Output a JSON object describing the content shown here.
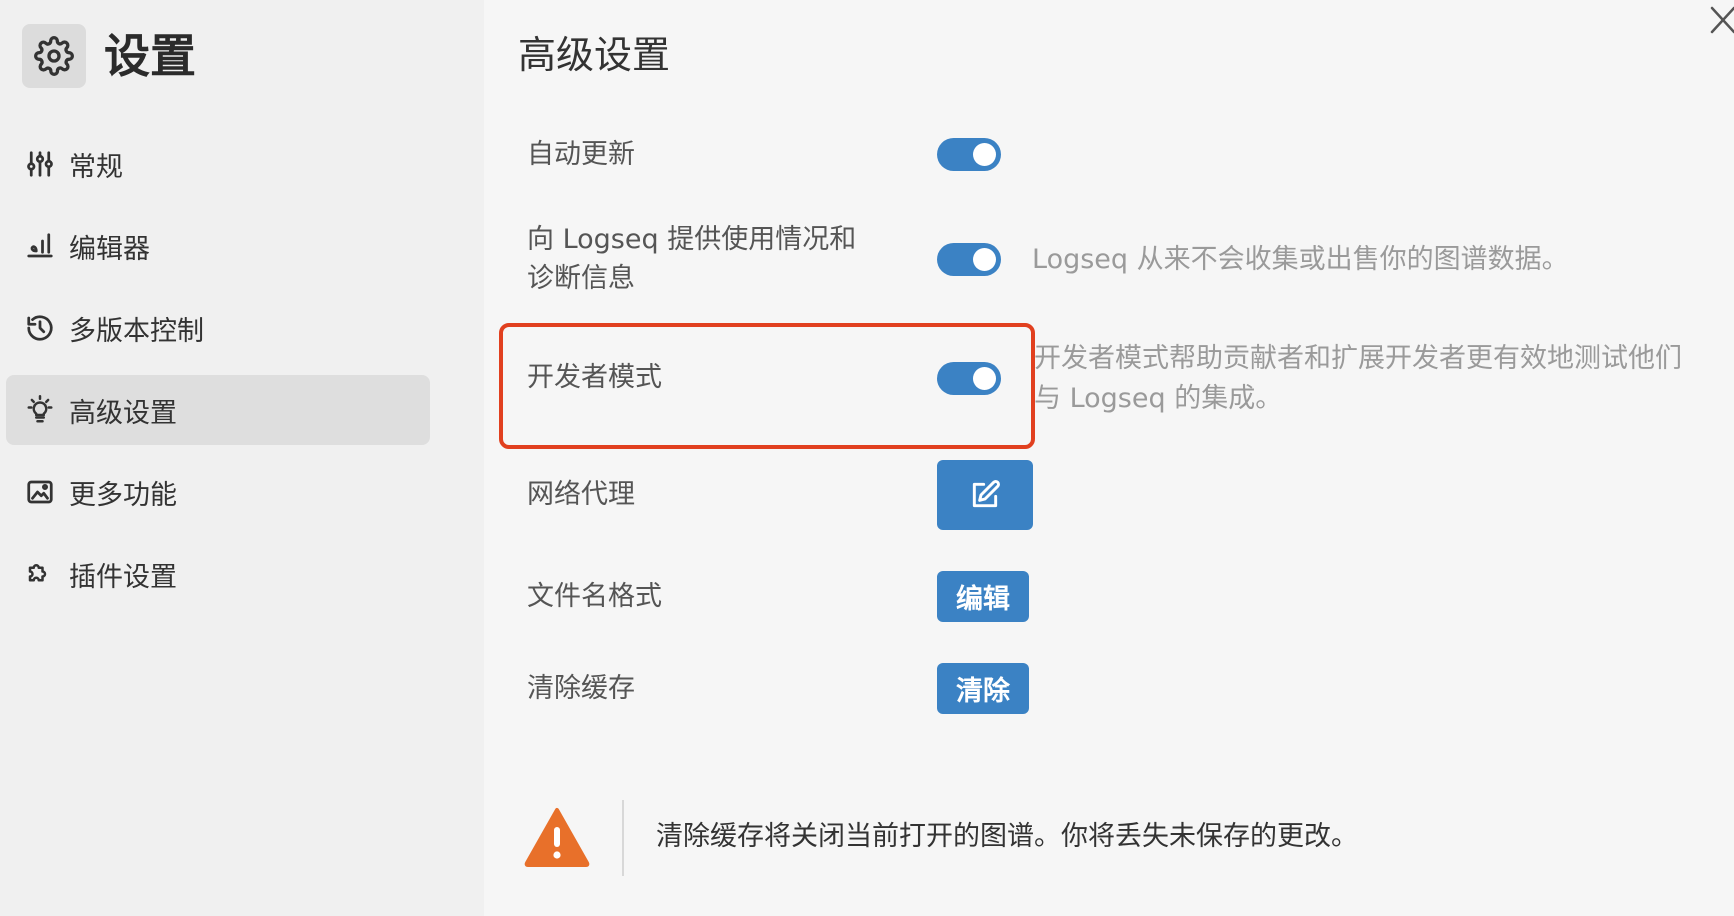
{
  "sidebar": {
    "title": "设置",
    "items": [
      {
        "label": "常规",
        "icon": "sliders-icon"
      },
      {
        "label": "编辑器",
        "icon": "editor-icon"
      },
      {
        "label": "多版本控制",
        "icon": "history-icon"
      },
      {
        "label": "高级设置",
        "icon": "bulb-icon",
        "active": true
      },
      {
        "label": "更多功能",
        "icon": "photo-icon"
      },
      {
        "label": "插件设置",
        "icon": "puzzle-icon"
      }
    ]
  },
  "main": {
    "title": "高级设置",
    "rows": {
      "auto_update": {
        "label": "自动更新",
        "enabled": true
      },
      "telemetry": {
        "label_line1": "向 Logseq 提供使用情况和",
        "label_line2": "诊断信息",
        "enabled": true,
        "description": "Logseq 从来不会收集或出售你的图谱数据。"
      },
      "developer_mode": {
        "label": "开发者模式",
        "enabled": true,
        "description_line1": "开发者模式帮助贡献者和扩展开发者更有效地测试他们",
        "description_line2": "与 Logseq 的集成。"
      },
      "network_proxy": {
        "label": "网络代理",
        "button_icon": "edit-icon"
      },
      "filename_format": {
        "label": "文件名格式",
        "button_label": "编辑"
      },
      "clear_cache": {
        "label": "清除缓存",
        "button_label": "清除"
      }
    },
    "warning": {
      "icon": "warning-icon",
      "text": "清除缓存将关闭当前打开的图谱。你将丢失未保存的更改。"
    }
  },
  "colors": {
    "accent": "#3b82c4",
    "highlight": "#e1401f",
    "warning": "#e8702a"
  }
}
